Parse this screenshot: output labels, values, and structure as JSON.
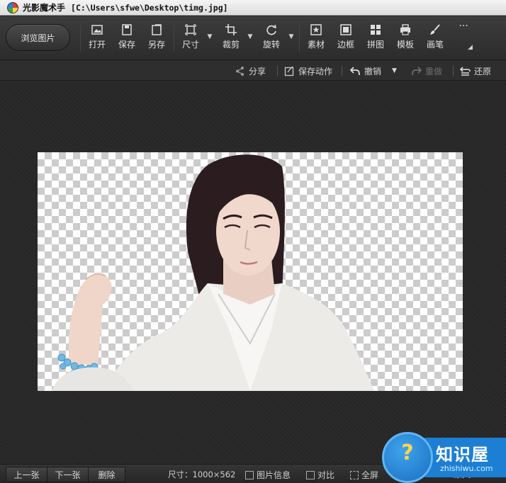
{
  "window": {
    "app_name": "光影魔术手",
    "file_path": "[C:\\Users\\sfwe\\Desktop\\timg.jpg]"
  },
  "toolbar": {
    "browse_label": "浏览图片",
    "tools": [
      {
        "label": "打开",
        "icon": "open-image-icon"
      },
      {
        "label": "保存",
        "icon": "save-icon"
      },
      {
        "label": "另存",
        "icon": "save-as-icon"
      },
      {
        "label": "尺寸",
        "icon": "resize-icon"
      },
      {
        "label": "裁剪",
        "icon": "crop-icon"
      },
      {
        "label": "旋转",
        "icon": "rotate-icon"
      },
      {
        "label": "素材",
        "icon": "material-star-icon"
      },
      {
        "label": "边框",
        "icon": "border-frame-icon"
      },
      {
        "label": "拼图",
        "icon": "collage-grid-icon"
      },
      {
        "label": "模板",
        "icon": "template-printer-icon"
      },
      {
        "label": "画笔",
        "icon": "brush-icon"
      }
    ],
    "more": "···"
  },
  "actionbar": {
    "share": "分享",
    "save_action": "保存动作",
    "undo": "撤销",
    "redo": "重做",
    "restore": "还原"
  },
  "statusbar": {
    "prev": "上一张",
    "next": "下一张",
    "delete": "删除",
    "size": "尺寸：1000×562",
    "info": "图片信息",
    "compare": "对比",
    "fullscreen": "全屏",
    "zoom_partial": "原大"
  },
  "watermark": {
    "title": "知识屋",
    "url": "zhishiwu.com"
  },
  "colors": {
    "toolbar_bg": "#333333",
    "canvas_bg": "#282828",
    "watermark_blue": "#1c7fd4"
  }
}
